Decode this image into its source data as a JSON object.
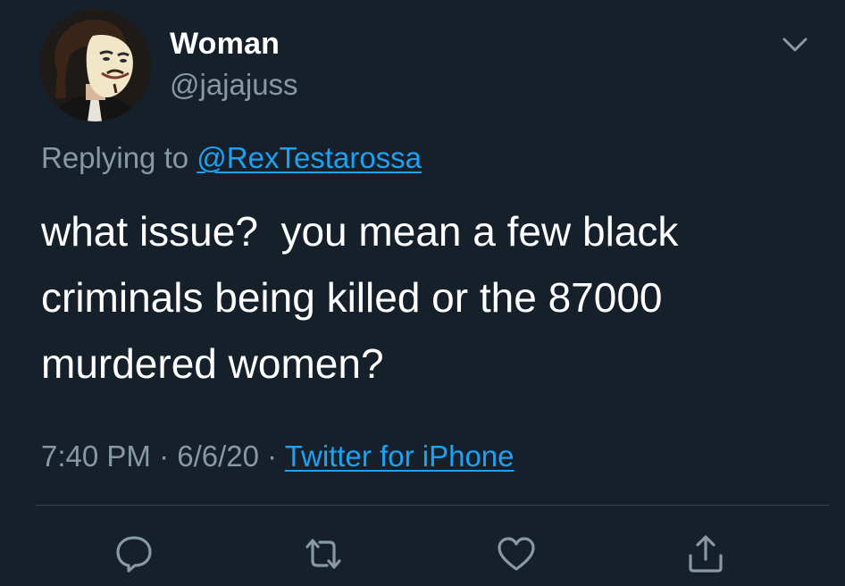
{
  "author": {
    "display_name": "Woman",
    "handle": "@jajajuss",
    "avatar_icon": "guy-fawkes-mask-avatar"
  },
  "reply_context": {
    "prefix": "Replying to ",
    "mention": "@RexTestarossa"
  },
  "tweet": {
    "text": "what issue?  you mean a few black criminals being killed or the 87000 murdered women?"
  },
  "meta": {
    "time": "7:40 PM",
    "separator": " · ",
    "date": "6/6/20",
    "source": "Twitter for iPhone"
  },
  "actions": [
    {
      "name": "reply",
      "icon": "reply-icon"
    },
    {
      "name": "retweet",
      "icon": "retweet-icon"
    },
    {
      "name": "like",
      "icon": "heart-icon"
    },
    {
      "name": "share",
      "icon": "share-icon"
    }
  ],
  "colors": {
    "background": "#15202b",
    "text_primary": "#ffffff",
    "text_secondary": "#8899a6",
    "accent": "#1da1f2",
    "divider": "#38444d"
  }
}
